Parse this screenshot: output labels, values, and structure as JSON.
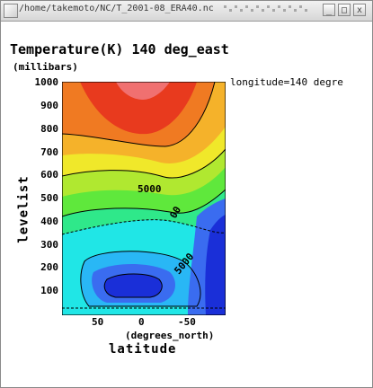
{
  "window": {
    "title": "/home/takemoto/NC/T_2001-08_ERA40.nc",
    "buttons": {
      "minimize": "_",
      "maximize": "□",
      "close": "x"
    }
  },
  "plot": {
    "title": "Temperature(K) 140 deg_east",
    "y_units": "(millibars)",
    "side_note": "longitude=140 degre",
    "y_axis_title": "levelist",
    "x_axis_title": "latitude",
    "x_units": "(degrees_north)",
    "y_ticks": [
      "1000",
      "900",
      "800",
      "700",
      "600",
      "500",
      "400",
      "300",
      "200",
      "100"
    ],
    "x_ticks": [
      "50",
      "0",
      "-50"
    ],
    "contour_labels": [
      "5000",
      "00",
      "5000"
    ]
  },
  "chart_data": {
    "type": "heatmap",
    "title": "Temperature(K) 140 deg_east",
    "xlabel": "latitude",
    "ylabel": "levelist",
    "y_reversed": true,
    "colors": [
      "#1a2fd8",
      "#3a6cf0",
      "#29b7f5",
      "#20e6e6",
      "#2fe88a",
      "#5fe83c",
      "#b0e830",
      "#f0e82a",
      "#f5b22a",
      "#f07a22",
      "#e83a1e",
      "#f07070"
    ],
    "contour_labels": [
      "5000",
      "00",
      "5000"
    ]
  }
}
